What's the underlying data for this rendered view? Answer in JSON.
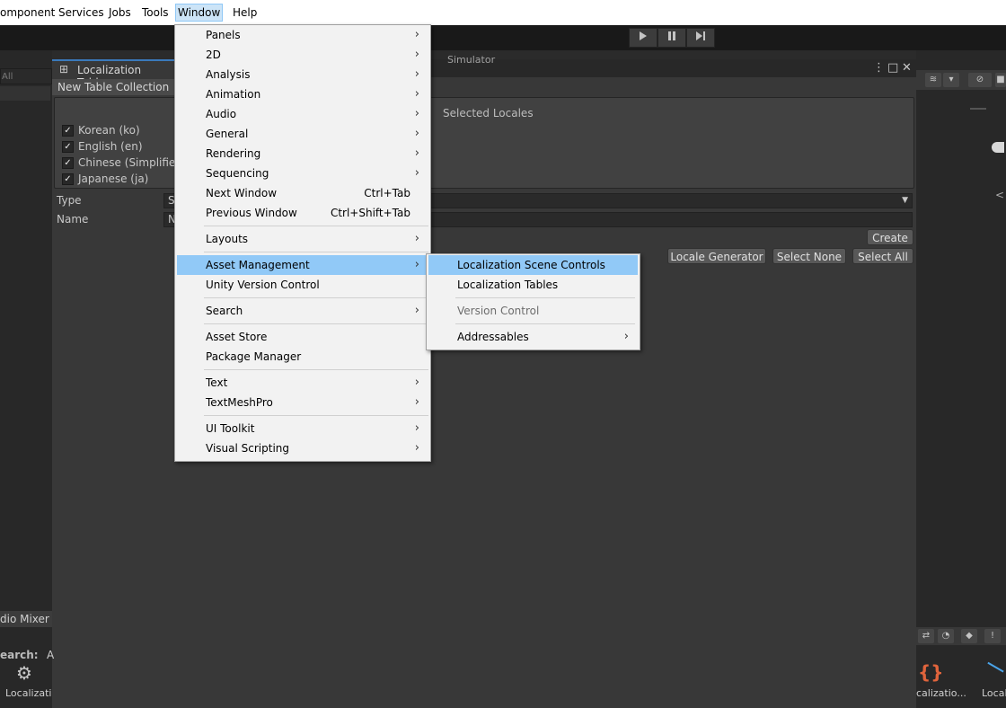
{
  "menubar": {
    "items": [
      "omponent",
      "Services",
      "Jobs",
      "Tools",
      "Window",
      "Help"
    ],
    "active": "Window"
  },
  "toolbar": {
    "play_icon": "play-icon",
    "pause_icon": "pause-icon",
    "step_icon": "step-icon"
  },
  "left_panel": {
    "search_fragment": "All"
  },
  "loc_window": {
    "title": "Localization Tables",
    "simulator_tab": "Simulator",
    "new_table_tab": "New Table Collection",
    "locales": [
      {
        "label": "Korean (ko)",
        "checked": true
      },
      {
        "label": "English (en)",
        "checked": true
      },
      {
        "label": "Chinese (Simplified",
        "checked": true
      },
      {
        "label": "Japanese (ja)",
        "checked": true
      }
    ],
    "selected_locales_label": "Selected Locales",
    "type_label": "Type",
    "type_value": "S",
    "name_label": "Name",
    "name_value": "N",
    "create_button": "Create",
    "locale_generator_button": "Locale Generator",
    "select_none_button": "Select None",
    "select_all_button": "Select All"
  },
  "bottom": {
    "audio_mixer_tab": "dio Mixer",
    "search_label": "earch:",
    "search_fragment": "A",
    "asset_left_label": "Localizati",
    "asset_right1_label": "calizatio...",
    "asset_right2_label": "Locali"
  },
  "window_menu": {
    "items": [
      {
        "label": "Panels",
        "submenu": true
      },
      {
        "label": "2D",
        "submenu": true
      },
      {
        "label": "Analysis",
        "submenu": true
      },
      {
        "label": "Animation",
        "submenu": true
      },
      {
        "label": "Audio",
        "submenu": true
      },
      {
        "label": "General",
        "submenu": true
      },
      {
        "label": "Rendering",
        "submenu": true
      },
      {
        "label": "Sequencing",
        "submenu": true
      },
      {
        "label": "Next Window",
        "shortcut": "Ctrl+Tab"
      },
      {
        "label": "Previous Window",
        "shortcut": "Ctrl+Shift+Tab"
      },
      {
        "label": "Layouts",
        "submenu": true
      },
      {
        "label": "Asset Management",
        "submenu": true,
        "highlight": true
      },
      {
        "label": "Unity Version Control"
      },
      {
        "label": "Search",
        "submenu": true
      },
      {
        "label": "Asset Store"
      },
      {
        "label": "Package Manager"
      },
      {
        "label": "Text",
        "submenu": true
      },
      {
        "label": "TextMeshPro",
        "submenu": true
      },
      {
        "label": "UI Toolkit",
        "submenu": true
      },
      {
        "label": "Visual Scripting",
        "submenu": true
      }
    ]
  },
  "asset_submenu": {
    "items": [
      {
        "label": "Localization Scene Controls",
        "highlight": true
      },
      {
        "label": "Localization Tables"
      },
      {
        "label": "Version Control",
        "disabled": true
      },
      {
        "label": "Addressables",
        "submenu": true
      }
    ]
  },
  "colors": {
    "highlight": "#91c9f7",
    "menu_bg": "#f2f2f2",
    "editor_bg": "#383838"
  }
}
